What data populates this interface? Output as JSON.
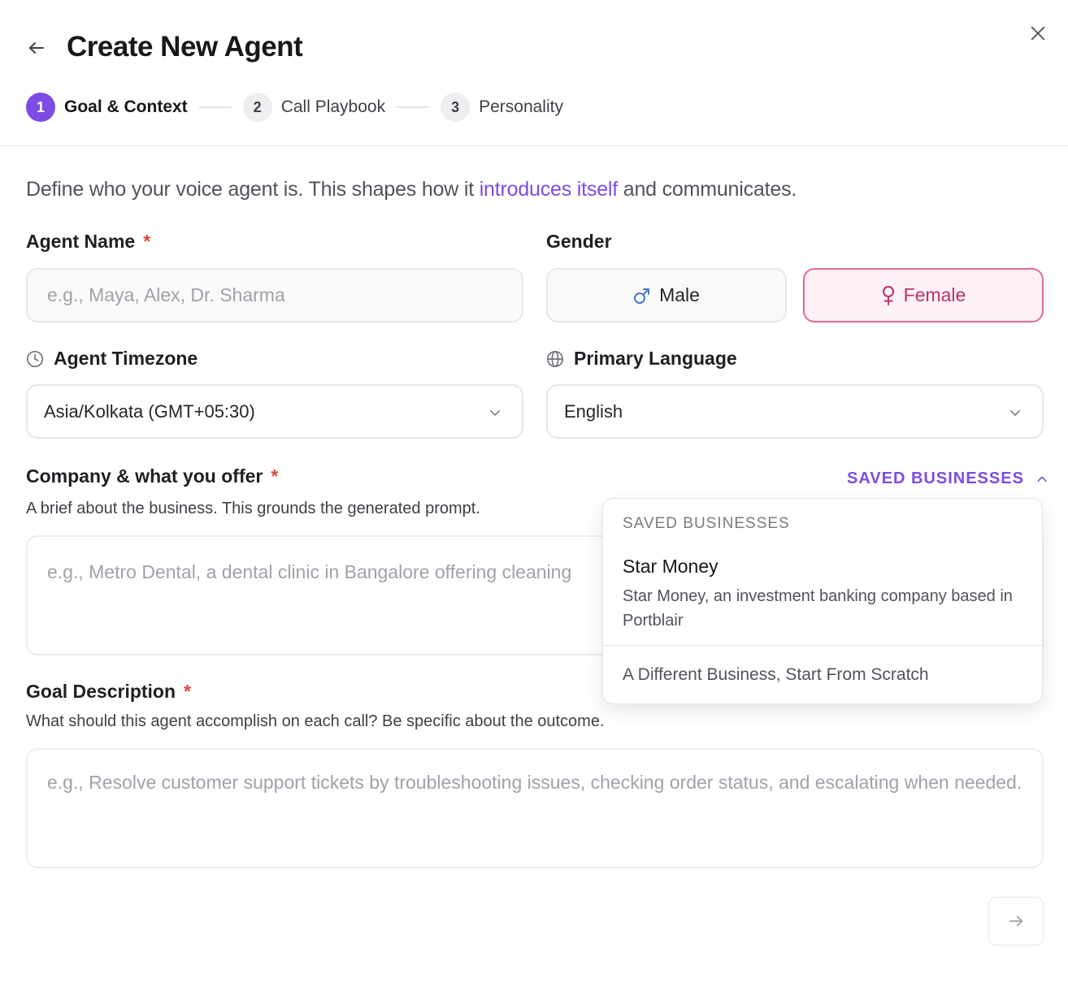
{
  "header": {
    "title": "Create New Agent",
    "back_icon": "arrow-left-icon",
    "close_icon": "close-icon"
  },
  "stepper": {
    "steps": [
      {
        "number": "1",
        "label": "Goal & Context",
        "active": true
      },
      {
        "number": "2",
        "label": "Call Playbook",
        "active": false
      },
      {
        "number": "3",
        "label": "Personality",
        "active": false
      }
    ]
  },
  "intro": {
    "before": "Define who your voice agent is. This shapes how it ",
    "highlight": "introduces itself",
    "after": " and communicates."
  },
  "agent_name": {
    "label": "Agent Name",
    "required": "*",
    "placeholder": "e.g., Maya, Alex, Dr. Sharma"
  },
  "gender": {
    "label": "Gender",
    "male": "Male",
    "female": "Female",
    "selected": "Female"
  },
  "timezone": {
    "label": "Agent Timezone",
    "value": "Asia/Kolkata (GMT+05:30)"
  },
  "language": {
    "label": "Primary Language",
    "value": "English"
  },
  "company": {
    "label": "Company & what you offer",
    "required": "*",
    "help": "A brief about the business. This grounds the generated prompt.",
    "placeholder": "e.g., Metro Dental, a dental clinic in Bangalore offering cleaning",
    "saved_toggle": "SAVED BUSINESSES"
  },
  "saved_dropdown": {
    "header": "SAVED BUSINESSES",
    "items": [
      {
        "name": "Star Money",
        "description": "Star Money, an investment banking company based in Portblair"
      }
    ],
    "scratch_option": "A Different Business, Start From Scratch"
  },
  "goal": {
    "label": "Goal Description",
    "required": "*",
    "help": "What should this agent accomplish on each call? Be specific about the outcome.",
    "placeholder": "e.g., Resolve customer support tickets by troubleshooting issues, checking order status, and escalating when needed."
  },
  "colors": {
    "accent": "#7c4ce3",
    "female_border": "#e2699a",
    "female_text": "#b8326a",
    "required": "#e0453a"
  }
}
